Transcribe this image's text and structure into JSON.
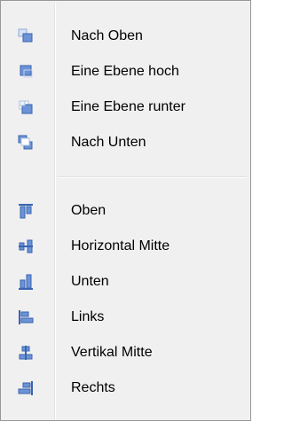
{
  "menu": {
    "arrange": [
      {
        "label": "Nach Oben",
        "icon": "bring-to-front-icon"
      },
      {
        "label": "Eine Ebene hoch",
        "icon": "bring-forward-icon"
      },
      {
        "label": "Eine Ebene runter",
        "icon": "send-backward-icon"
      },
      {
        "label": "Nach Unten",
        "icon": "send-to-back-icon"
      }
    ],
    "align": [
      {
        "label": "Oben",
        "icon": "align-top-icon"
      },
      {
        "label": "Horizontal Mitte",
        "icon": "align-horizontal-center-icon"
      },
      {
        "label": "Unten",
        "icon": "align-bottom-icon"
      },
      {
        "label": "Links",
        "icon": "align-left-icon"
      },
      {
        "label": "Vertikal Mitte",
        "icon": "align-vertical-center-icon"
      },
      {
        "label": "Rechts",
        "icon": "align-right-icon"
      }
    ]
  },
  "colors": {
    "menu_background": "#f0f0f0",
    "icon_fill": "#6b93d6",
    "icon_stroke": "#3a64b0",
    "icon_ghost": "#d7e3f7"
  }
}
